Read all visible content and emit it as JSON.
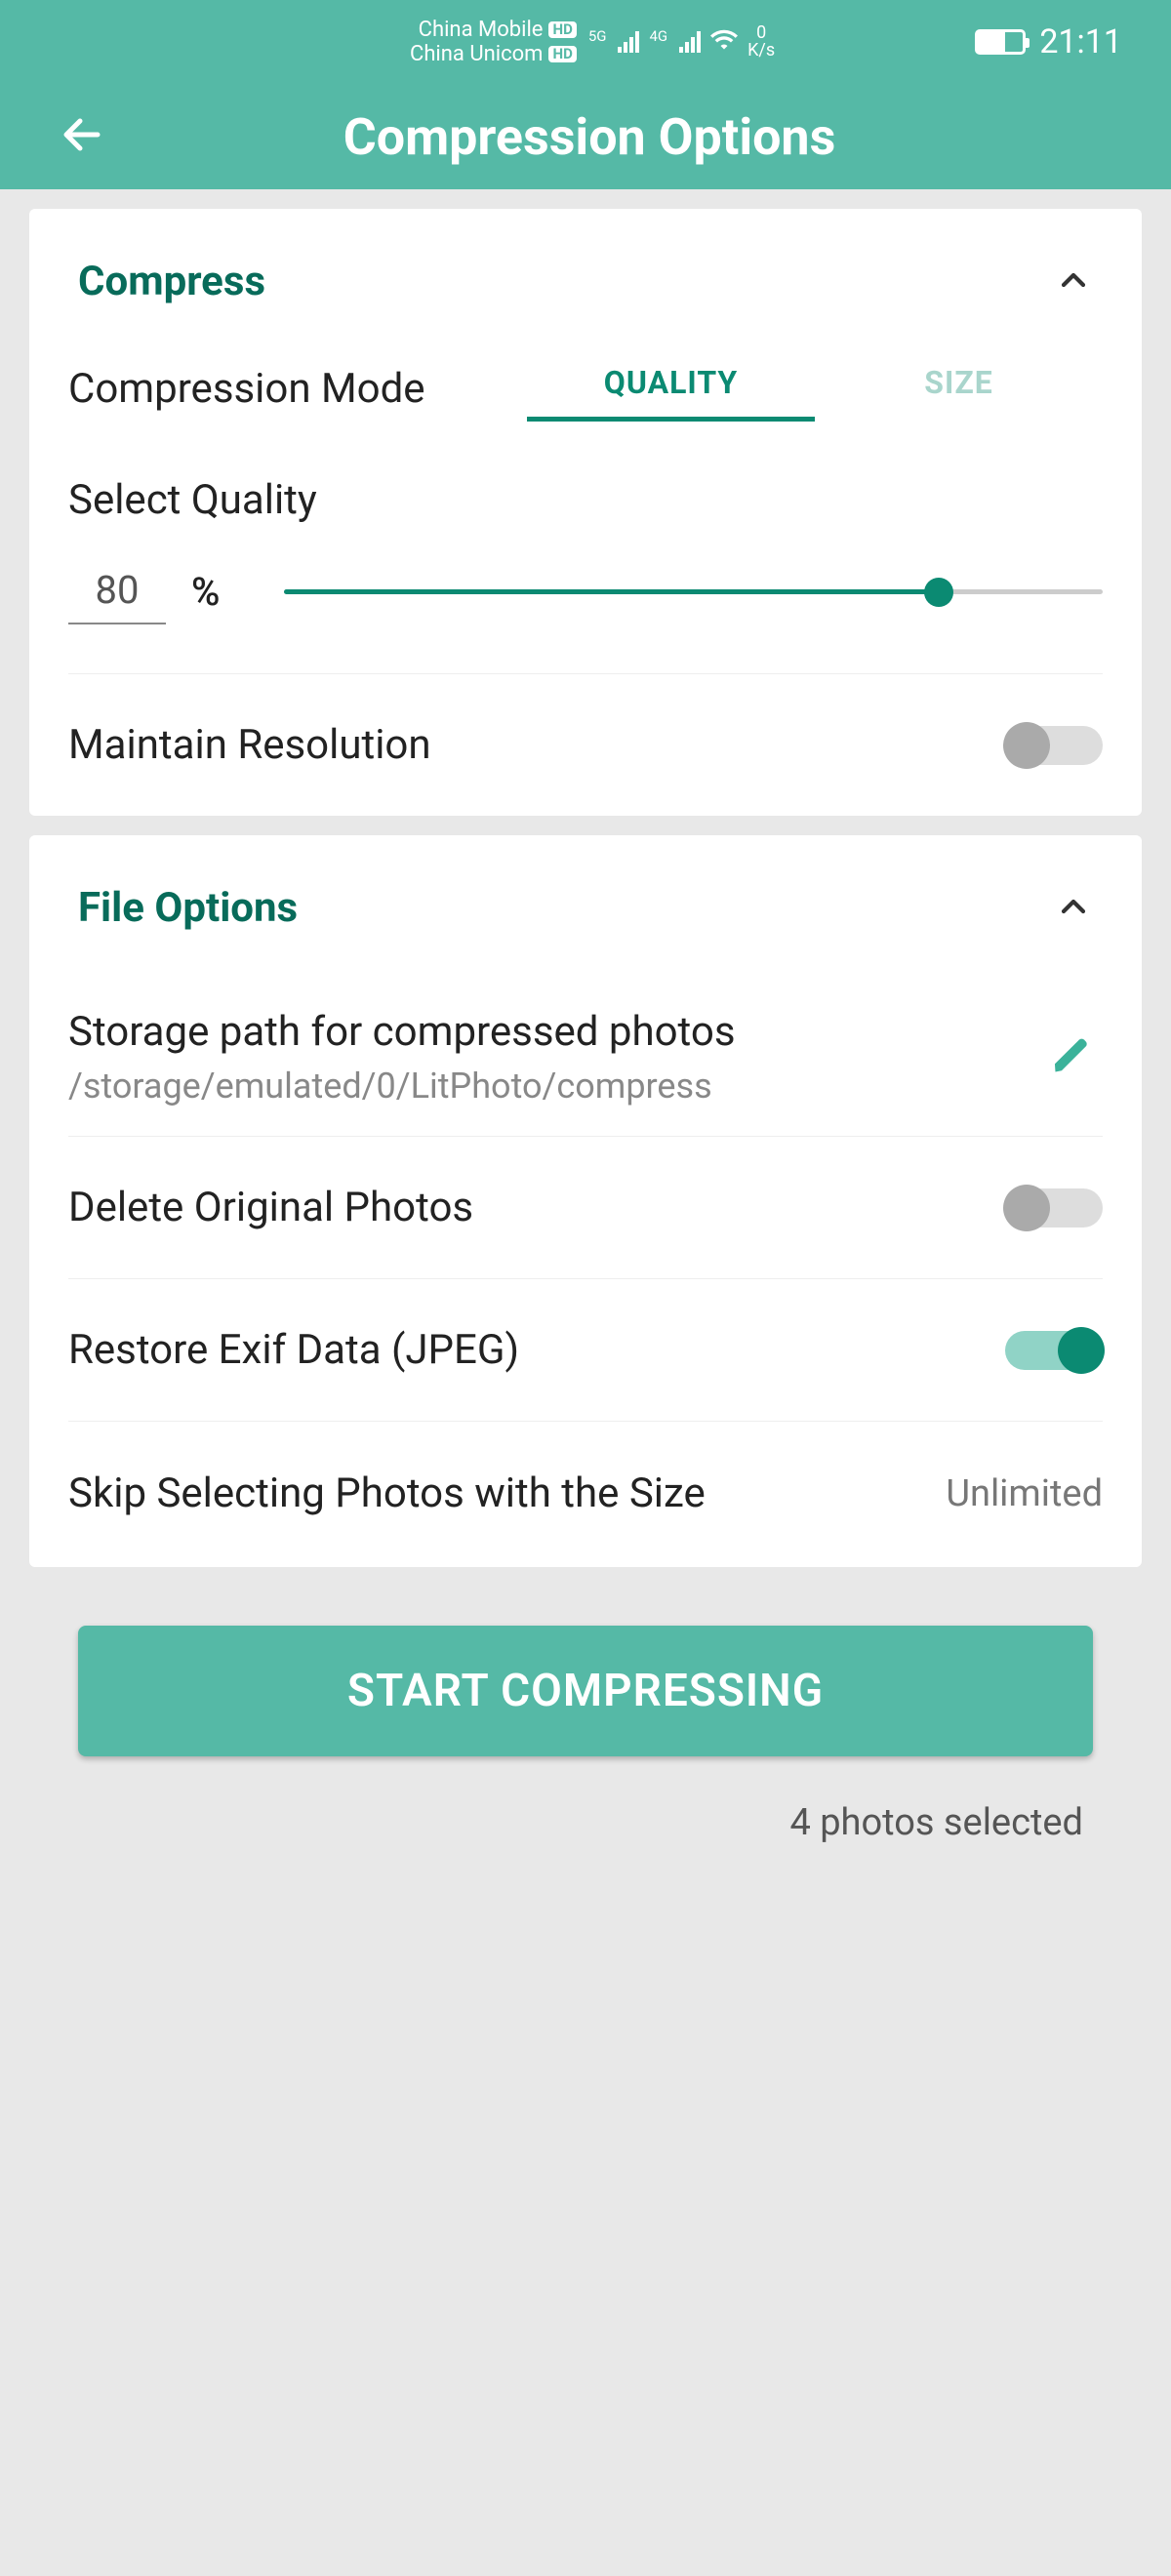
{
  "status": {
    "carrier1": "China Mobile",
    "carrier2": "China Unicom",
    "net1_label": "5G",
    "net2_label": "4G",
    "speed_num": "0",
    "speed_unit": "K/s",
    "time": "21:11"
  },
  "header": {
    "title": "Compression Options"
  },
  "compress": {
    "section_title": "Compress",
    "mode_label": "Compression Mode",
    "tabs": {
      "quality": "QUALITY",
      "size": "SIZE"
    },
    "select_quality_label": "Select Quality",
    "quality_value": "80",
    "pct": "%",
    "maintain_resolution_label": "Maintain Resolution",
    "maintain_resolution_on": false
  },
  "file_options": {
    "section_title": "File Options",
    "storage_title": "Storage path for compressed photos",
    "storage_path": "/storage/emulated/0/LitPhoto/compress",
    "delete_original_label": "Delete Original Photos",
    "delete_original_on": false,
    "restore_exif_label": "Restore Exif Data (JPEG)",
    "restore_exif_on": true,
    "skip_size_label": "Skip Selecting Photos with the Size",
    "skip_size_value": "Unlimited"
  },
  "action": {
    "button": "START COMPRESSING",
    "selected": "4 photos selected"
  }
}
